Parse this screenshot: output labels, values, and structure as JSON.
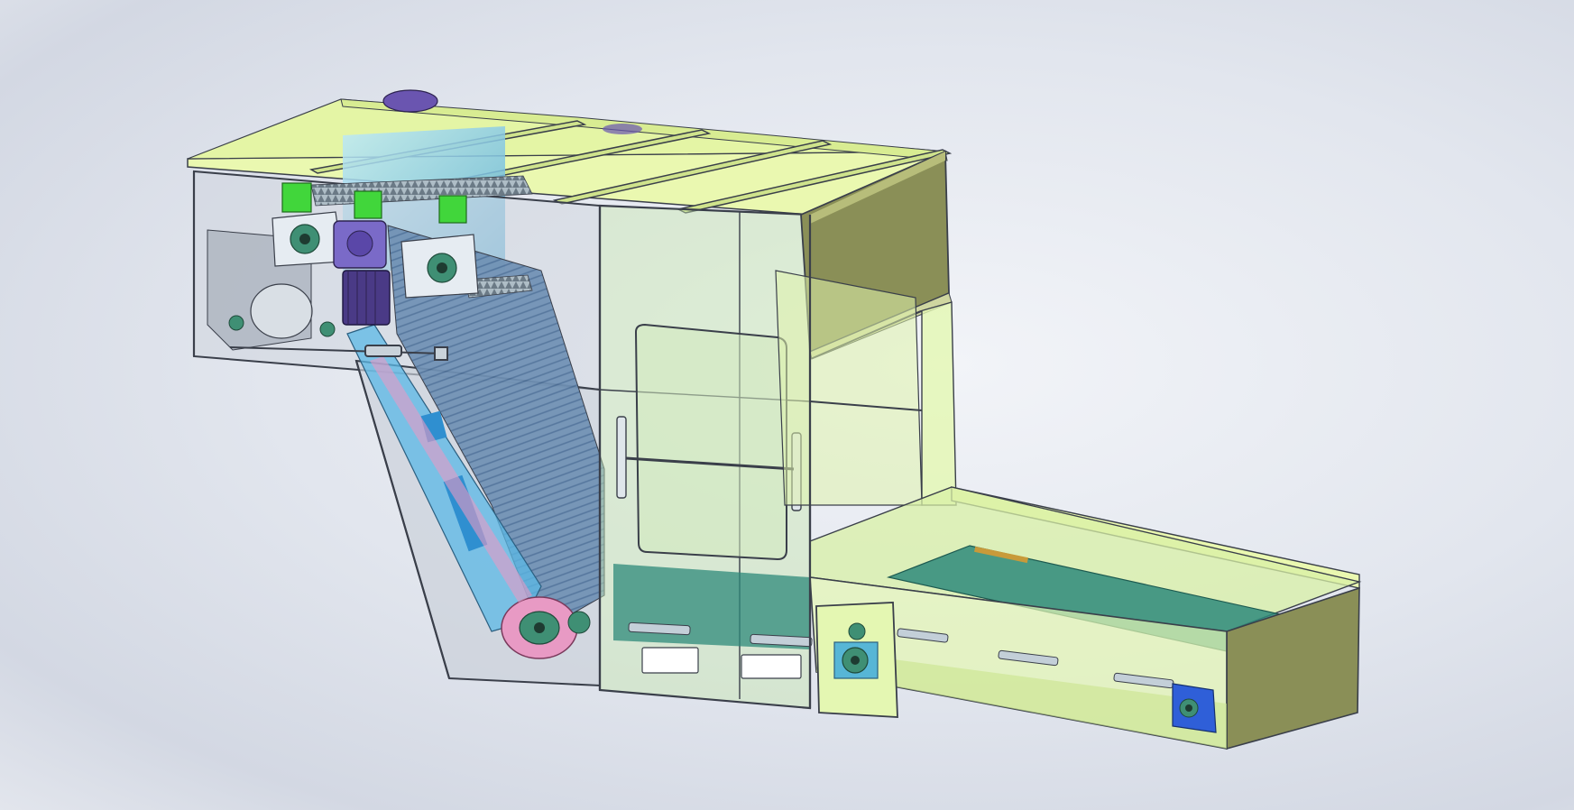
{
  "viewport": {
    "background_top": "#f3f5f8",
    "background_mid": "#d6dae4"
  },
  "model": {
    "colors": {
      "hopper_panel": "#eaf8b0",
      "hopper_side": "#8a8f57",
      "glass": "#c8e6b0",
      "frame_edge": "#3a3f4a",
      "conveyor_belt": "#2e8a7a",
      "drum": "#8fd3ec",
      "bearing": "#2f6f55",
      "bracket": "#41d63b",
      "motor": "#6a55b0",
      "roller_pink": "#e89ac4",
      "guide_blue": "#5bb8e6",
      "end_bracket": "#2f5fd8"
    },
    "icons": [
      "bearing-icon",
      "motor-icon",
      "door-handle-icon"
    ]
  }
}
